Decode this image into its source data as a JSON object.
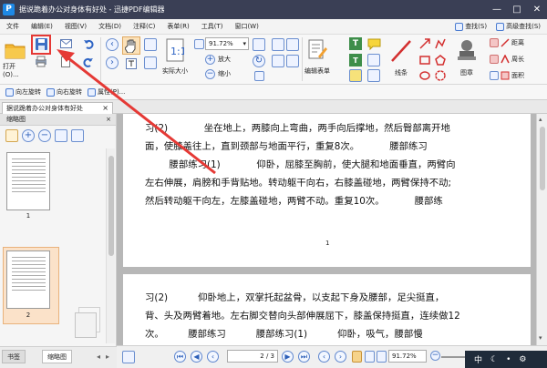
{
  "app": {
    "title": "据说跪着办公对身体有好处 - 迅捷PDF编辑器",
    "logo_letter": "P"
  },
  "menu": {
    "items": [
      "文件",
      "编辑(E)",
      "视图(V)",
      "文档(D)",
      "注释(C)",
      "表单(R)",
      "工具(T)",
      "窗口(W)"
    ],
    "search_label": "查找(S)",
    "advanced_search_label": "高级查找(S)"
  },
  "toolbar": {
    "open_label": "打开(O)...",
    "zoom_value": "91.72%",
    "actual_size_label": "实际大小",
    "zoom_in_label": "放大",
    "zoom_out_label": "缩小",
    "edit_form_label": "编辑表单",
    "lines_label": "线条",
    "stamp_label": "图章",
    "distance_label": "距离",
    "perimeter_label": "周长",
    "area_label": "面积"
  },
  "quickbar": {
    "rotate_left": "向左旋转",
    "rotate_right": "向右旋转",
    "properties": "属性(P)..."
  },
  "document_tab": {
    "label": "据说跪着办公对身体有好处"
  },
  "thumbnail_panel": {
    "title": "缩略图",
    "pages": [
      "1",
      "2"
    ],
    "selected_page": "2"
  },
  "panel_tabs": {
    "bookmarks": "书签",
    "thumbnails": "缩略图"
  },
  "page1": {
    "lines": [
      "习(2)            坐在地上，两膝向上弯曲，两手向后撑地，然后臀部离开地",
      "面，使膝盖往上，直到颈部与地面平行，重复8次。          腰部练习",
      "        腰部练习(1)            仰卧，屈膝至胸前，使大腿和地面垂直，两臂向",
      "左右伸展，肩膀和手背贴地。转动躯干向右，右膝盖碰地，两臂保持不动;",
      "然后转动躯干向左，左膝盖碰地，两臂不动。重复10次。          腰部练"
    ],
    "page_number": "1"
  },
  "page2": {
    "lines": [
      "习(2)          仰卧地上，双掌托起盆骨，以支起下身及腰部，足尖挺直，",
      "背、头及两臂着地。左右脚交替向头部伸展屈下，膝盖保持挺直，连续做12",
      "次。        腰部练习          腰部练习(1)          仰卧，吸气，腰部慢"
    ]
  },
  "statusbar": {
    "page_indicator": "2 / 3",
    "zoom_value": "91.72%"
  },
  "ime": {
    "lang": "中",
    "moon": "☾",
    "dot": "•",
    "gear": "⚙"
  },
  "colors": {
    "titlebar": "#3a3f55",
    "highlight": "#e53935",
    "accent": "#1e88e5"
  }
}
